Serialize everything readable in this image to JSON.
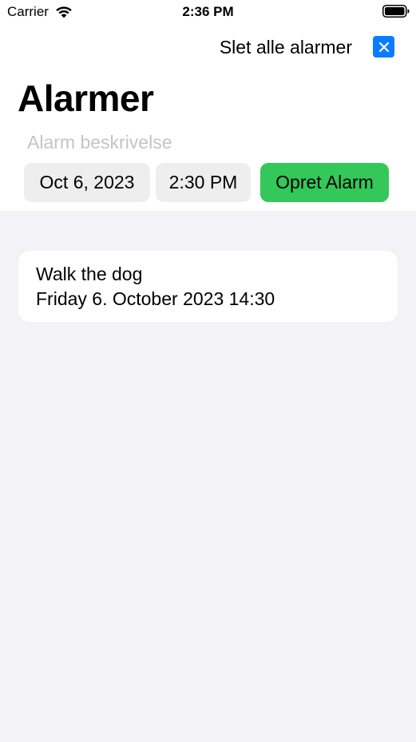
{
  "status_bar": {
    "carrier": "Carrier",
    "time": "2:36 PM"
  },
  "header": {
    "delete_all_label": "Slet alle alarmer",
    "close_icon": "close-icon",
    "title": "Alarmer"
  },
  "form": {
    "description_placeholder": "Alarm beskrivelse",
    "description_value": "",
    "date": "Oct 6, 2023",
    "time": "2:30 PM",
    "create_label": "Opret Alarm"
  },
  "alarms": [
    {
      "title": "Walk the dog",
      "datetime": "Friday 6. October 2023 14:30"
    }
  ],
  "colors": {
    "accent_blue": "#0a7cff",
    "create_green": "#34c759",
    "background": "#f2f2f7",
    "pill_gray": "#eeeeef",
    "placeholder_gray": "#c4c4c7"
  }
}
